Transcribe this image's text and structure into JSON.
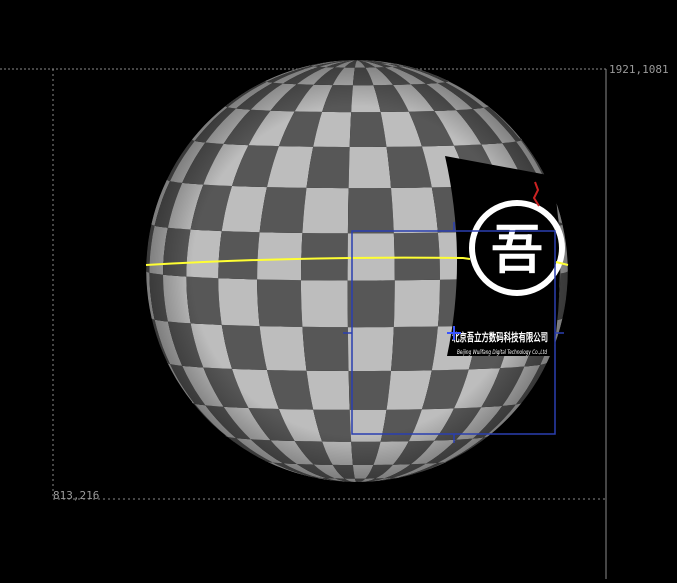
{
  "viewer": {
    "coords": {
      "top_right": "1921,1081",
      "bottom_left": "813,216"
    },
    "logo": {
      "glyph": "吾",
      "company_cn": "北京吾立方数码科技有限公司",
      "company_en": "Beijing Wulifang Digital Technology Co.,Ltd"
    },
    "colors": {
      "background": "#000000",
      "checker_light": "#bdbdbd",
      "checker_dark": "#575757",
      "equator_line": "#ffff33",
      "selection_box": "#2a3fb0",
      "guide_line": "#8a8a8a"
    }
  }
}
